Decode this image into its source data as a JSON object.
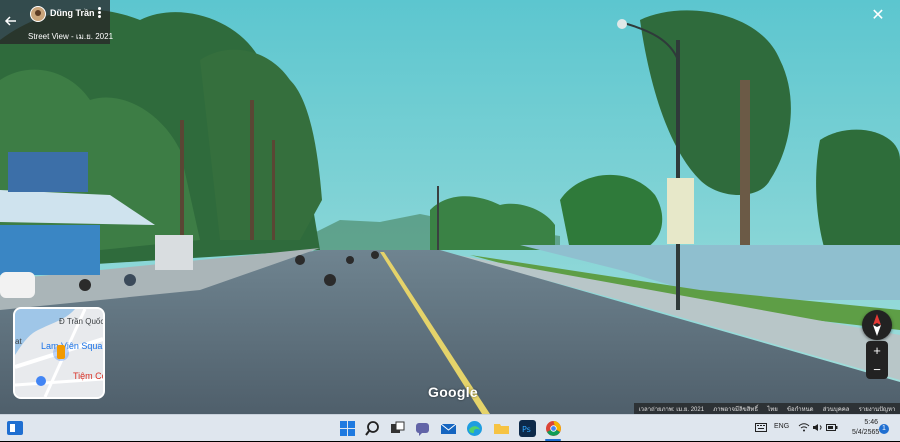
{
  "top_card": {
    "author": "Dũng Trần",
    "date_label": "Street View - เม.ย. 2021"
  },
  "minimap": {
    "street_label": "Đ Trần Quốc To",
    "place_label_1": "Lam Viên Squar",
    "place_label_2": "Tiệm Cơ",
    "edge_label": "at"
  },
  "watermark": "Google",
  "bottom_bar": {
    "items": [
      "เวลาถ่ายภาพ: เม.ย. 2021",
      "ภาพอาจมีลิขสิทธิ์",
      "ไทย",
      "ข้อกำหนด",
      "ส่วนบุคคล",
      "รายงานปัญหา"
    ]
  },
  "zoom": {
    "in_label": "+",
    "out_label": "−"
  },
  "taskbar": {
    "language": "ENG",
    "time": "5:46",
    "date": "5/4/2565",
    "notification_count": "1"
  },
  "colors": {
    "sky": "#7ed3d8",
    "road": "#5a6b77",
    "taskbar": "#dfe6ee",
    "accent": "#1f6fd1"
  }
}
